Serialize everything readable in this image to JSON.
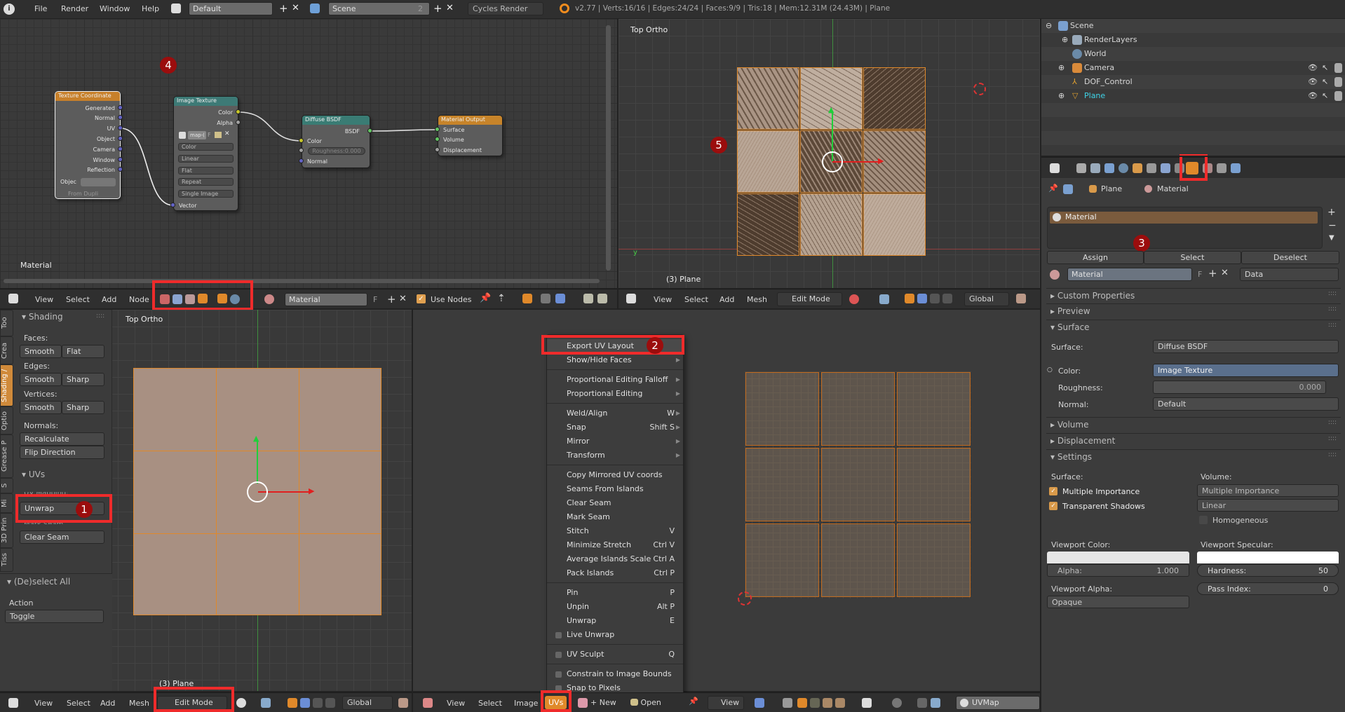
{
  "topbar": {
    "menus": [
      "File",
      "Render",
      "Window",
      "Help"
    ],
    "screen_layout": "Default",
    "scene": "Scene",
    "scene_users": "2",
    "engine": "Cycles Render",
    "stats": "v2.77 | Verts:16/16 | Edges:24/24 | Faces:9/9 | Tris:18 | Mem:12.31M (24.43M) | Plane"
  },
  "node_editor": {
    "label": "Material",
    "marker": "4",
    "texture_coordinate": {
      "title": "Texture Coordinate",
      "outputs": [
        "Generated",
        "Normal",
        "UV",
        "Object",
        "Camera",
        "Window",
        "Reflection"
      ],
      "object_label": "Objec",
      "from_dupli": "From Dupli"
    },
    "image_texture": {
      "title": "Image Texture",
      "outputs": [
        "Color",
        "Alpha"
      ],
      "image": "map-(",
      "fake_user": "F",
      "options": [
        "Color",
        "Linear",
        "Flat",
        "Repeat",
        "Single Image"
      ],
      "input": "Vector"
    },
    "diffuse": {
      "title": "Diffuse BSDF",
      "output": "BSDF",
      "inputs": [
        "Color",
        "Roughness:0.000",
        "Normal"
      ]
    },
    "material_output": {
      "title": "Material Output",
      "inputs": [
        "Surface",
        "Volume",
        "Displacement"
      ]
    },
    "header": {
      "menus": [
        "View",
        "Select",
        "Add",
        "Node"
      ],
      "material": "Material",
      "fake_user": "F",
      "use_nodes": "Use Nodes",
      "use_nodes_checked": true
    }
  },
  "viewport_top": {
    "view_label": "Top Ortho",
    "object_label": "(3) Plane",
    "marker": "5",
    "header": {
      "menus": [
        "View",
        "Select",
        "Add",
        "Mesh"
      ],
      "mode": "Edit Mode",
      "orientation": "Global"
    }
  },
  "viewport_bottom": {
    "view_label": "Top Ortho",
    "object_label": "(3) Plane",
    "header": {
      "menus": [
        "View",
        "Select",
        "Add",
        "Mesh"
      ],
      "mode": "Edit Mode",
      "orientation": "Global"
    }
  },
  "tool_shelf": {
    "tabs": [
      "Too",
      "Crea",
      "Shading /",
      "Optio",
      "Grease P",
      "S",
      "Mi",
      "3D Prin",
      "Tiss"
    ],
    "shading": {
      "title": "Shading",
      "faces": "Faces:",
      "edges": "Edges:",
      "vertices": "Vertices:",
      "normals": "Normals:",
      "smooth": "Smooth",
      "flat": "Flat",
      "sharp": "Sharp",
      "recalculate": "Recalculate",
      "flip": "Flip Direction"
    },
    "uvs": {
      "title": "UVs",
      "mapping": "UV Mapping:",
      "unwrap": "Unwrap",
      "mark_seam": "Mark Seam",
      "clear_seam": "Clear Seam",
      "marker": "1"
    },
    "operator": {
      "title": "(De)select All",
      "action_label": "Action",
      "action": "Toggle"
    }
  },
  "uv_editor": {
    "header": {
      "menus": [
        "View",
        "Select",
        "Image",
        "UVs"
      ],
      "new": "New",
      "open": "Open",
      "view": "View",
      "uv_map": "UVMap"
    },
    "menu": {
      "marker": "2",
      "items": [
        {
          "label": "Export UV Layout",
          "highlight": true
        },
        {
          "label": "Show/Hide Faces",
          "arrow": true
        },
        {
          "sep": true
        },
        {
          "label": "Proportional Editing Falloff",
          "arrow": true
        },
        {
          "label": "Proportional Editing",
          "arrow": true
        },
        {
          "sep": true
        },
        {
          "label": "Weld/Align",
          "shortcut": "W",
          "arrow": true
        },
        {
          "label": "Snap",
          "shortcut": "Shift S",
          "arrow": true
        },
        {
          "label": "Mirror",
          "arrow": true
        },
        {
          "label": "Transform",
          "arrow": true
        },
        {
          "sep": true
        },
        {
          "label": "Copy Mirrored UV coords"
        },
        {
          "label": "Seams From Islands"
        },
        {
          "label": "Clear Seam"
        },
        {
          "label": "Mark Seam"
        },
        {
          "label": "Stitch",
          "shortcut": "V"
        },
        {
          "label": "Minimize Stretch",
          "shortcut": "Ctrl V"
        },
        {
          "label": "Average Islands Scale",
          "shortcut": "Ctrl A"
        },
        {
          "label": "Pack Islands",
          "shortcut": "Ctrl P"
        },
        {
          "sep": true
        },
        {
          "label": "Pin",
          "shortcut": "P"
        },
        {
          "label": "Unpin",
          "shortcut": "Alt P"
        },
        {
          "label": "Unwrap",
          "shortcut": "E"
        },
        {
          "label": "Live Unwrap",
          "checkbox": true
        },
        {
          "sep": true
        },
        {
          "label": "UV Sculpt",
          "shortcut": "Q",
          "checkbox": true
        },
        {
          "sep": true
        },
        {
          "label": "Constrain to Image Bounds",
          "checkbox": true
        },
        {
          "label": "Snap to Pixels",
          "checkbox": true
        }
      ]
    }
  },
  "outliner": {
    "rows": [
      "Scene",
      "RenderLayers",
      "World",
      "Camera",
      "DOF_Control",
      "Plane"
    ]
  },
  "properties": {
    "breadcrumb": [
      "Plane",
      "Material"
    ],
    "slot": "Material",
    "marker": "3",
    "assign": "Assign",
    "select": "Select",
    "deselect": "Deselect",
    "material": "Material",
    "fake_user": "F",
    "link": "Data",
    "panels": {
      "custom": "Custom Properties",
      "preview": "Preview",
      "surface": "Surface",
      "volume": "Volume",
      "displacement": "Displacement",
      "settings": "Settings"
    },
    "surface": {
      "surface_label": "Surface:",
      "surface_value": "Diffuse BSDF",
      "color_label": "Color:",
      "color_value": "Image Texture",
      "roughness_label": "Roughness:",
      "roughness_value": "0.000",
      "normal_label": "Normal:",
      "normal_value": "Default"
    },
    "settings": {
      "surface_label": "Surface:",
      "multiple_importance": "Multiple Importance",
      "transparent_shadows": "Transparent Shadows",
      "volume_label": "Volume:",
      "volume_sampling": "Multiple Importance",
      "volume_interp": "Linear",
      "homogeneous": "Homogeneous",
      "viewport_color": "Viewport Color:",
      "alpha_label": "Alpha:",
      "alpha_value": "1.000",
      "viewport_specular": "Viewport Specular:",
      "hardness_label": "Hardness:",
      "hardness_value": "50",
      "pass_index_label": "Pass Index:",
      "pass_index_value": "0",
      "viewport_alpha": "Viewport Alpha:",
      "viewport_alpha_value": "Opaque"
    }
  },
  "colors": {
    "accent": "#e0892a",
    "highlight_box": "#ef2b2b",
    "marker": "#9b0d0d",
    "selected_text": "#3fd4e8"
  }
}
